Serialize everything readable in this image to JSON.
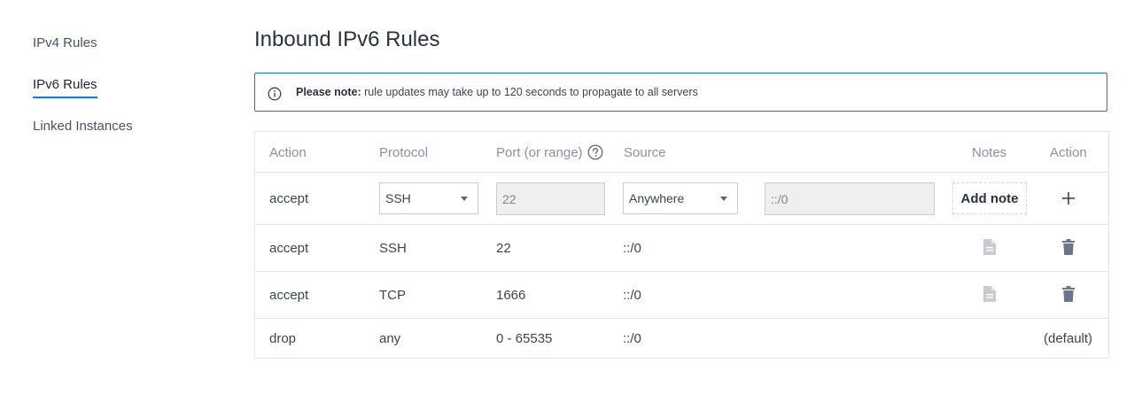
{
  "sidebar": {
    "items": [
      {
        "label": "IPv4 Rules",
        "active": false
      },
      {
        "label": "IPv6 Rules",
        "active": true
      },
      {
        "label": "Linked Instances",
        "active": false
      }
    ]
  },
  "page": {
    "title": "Inbound IPv6 Rules"
  },
  "notice": {
    "bold": "Please note:",
    "text": " rule updates may take up to 120 seconds to propagate to all servers",
    "icon": "info-icon",
    "border_color": "#1b7e93"
  },
  "table": {
    "headers": {
      "action": "Action",
      "protocol": "Protocol",
      "port": "Port (or range)",
      "port_help_icon": "help-icon",
      "source": "Source",
      "notes": "Notes",
      "action2": "Action"
    },
    "new_rule": {
      "action": "accept",
      "protocol": "SSH",
      "port": "22",
      "source": "Anywhere",
      "source_value": "::/0",
      "add_note": "Add note",
      "add_icon": "plus-icon"
    },
    "rows": [
      {
        "action": "accept",
        "protocol": "SSH",
        "port": "22",
        "source": "::/0",
        "note_icon": "document-icon",
        "delete_icon": "trash-icon"
      },
      {
        "action": "accept",
        "protocol": "TCP",
        "port": "1666",
        "source": "::/0",
        "note_icon": "document-icon",
        "delete_icon": "trash-icon"
      }
    ],
    "default_row": {
      "action": "drop",
      "protocol": "any",
      "port": "0 - 65535",
      "source": "::/0",
      "label": "(default)"
    }
  },
  "colors": {
    "accent": "#007bfc",
    "icon_gray": "#c9cbd0",
    "trash": "#6f7488"
  }
}
